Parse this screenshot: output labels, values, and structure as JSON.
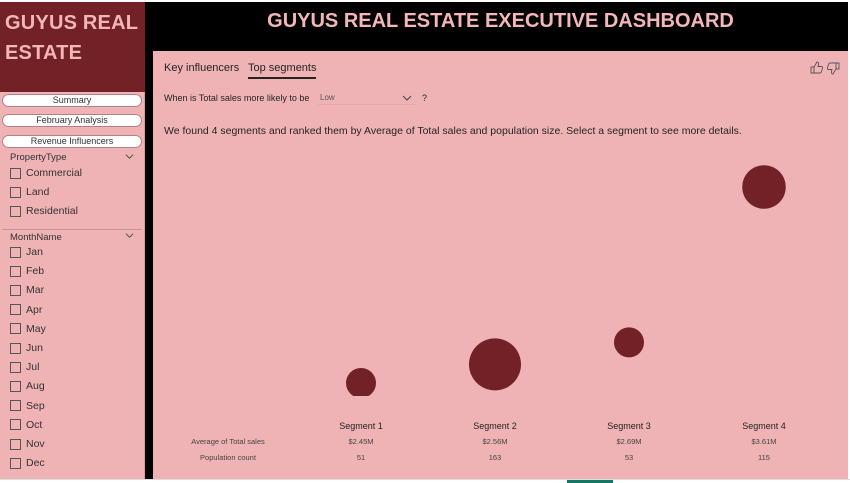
{
  "brand": {
    "title": "GUYUS REAL ESTATE"
  },
  "header": {
    "title": "GUYUS REAL ESTATE EXECUTIVE DASHBOARD"
  },
  "nav": {
    "summary": "Summary",
    "february": "February Analysis",
    "revenue": "Revenue Influencers"
  },
  "slicers": {
    "property": {
      "title": "PropertyType",
      "options": [
        "Commercial",
        "Land",
        "Residential"
      ]
    },
    "month": {
      "title": "MonthName",
      "options": [
        "Jan",
        "Feb",
        "Mar",
        "Apr",
        "May",
        "Jun",
        "Jul",
        "Aug",
        "Sep",
        "Oct",
        "Nov",
        "Dec"
      ]
    }
  },
  "visual": {
    "tabs": {
      "key": "Key influencers",
      "top": "Top segments"
    },
    "question": "When is Total sales more likely to be",
    "dropdown_value": "Low",
    "help": "?",
    "summary": "We found 4 segments and ranked them by Average of Total sales and population size. Select a segment to see more details.",
    "row_labels": {
      "avg": "Average of Total sales",
      "pop": "Population count"
    }
  },
  "chart_data": {
    "type": "scatter",
    "categories": [
      "Segment 1",
      "Segment 2",
      "Segment 3",
      "Segment 4"
    ],
    "series": [
      {
        "name": "Average of Total sales",
        "values": [
          2.45,
          2.56,
          2.69,
          3.61
        ],
        "labels": [
          "$2.45M",
          "$2.56M",
          "$2.69M",
          "$3.61M"
        ]
      },
      {
        "name": "Population count",
        "values": [
          51,
          163,
          53,
          115
        ]
      }
    ],
    "colors": {
      "bubble": "#722126"
    }
  },
  "colors": {
    "sidebar": "#efb3b6",
    "brand": "#722126",
    "title_text": "#f4b6b8",
    "header": "#000000"
  }
}
